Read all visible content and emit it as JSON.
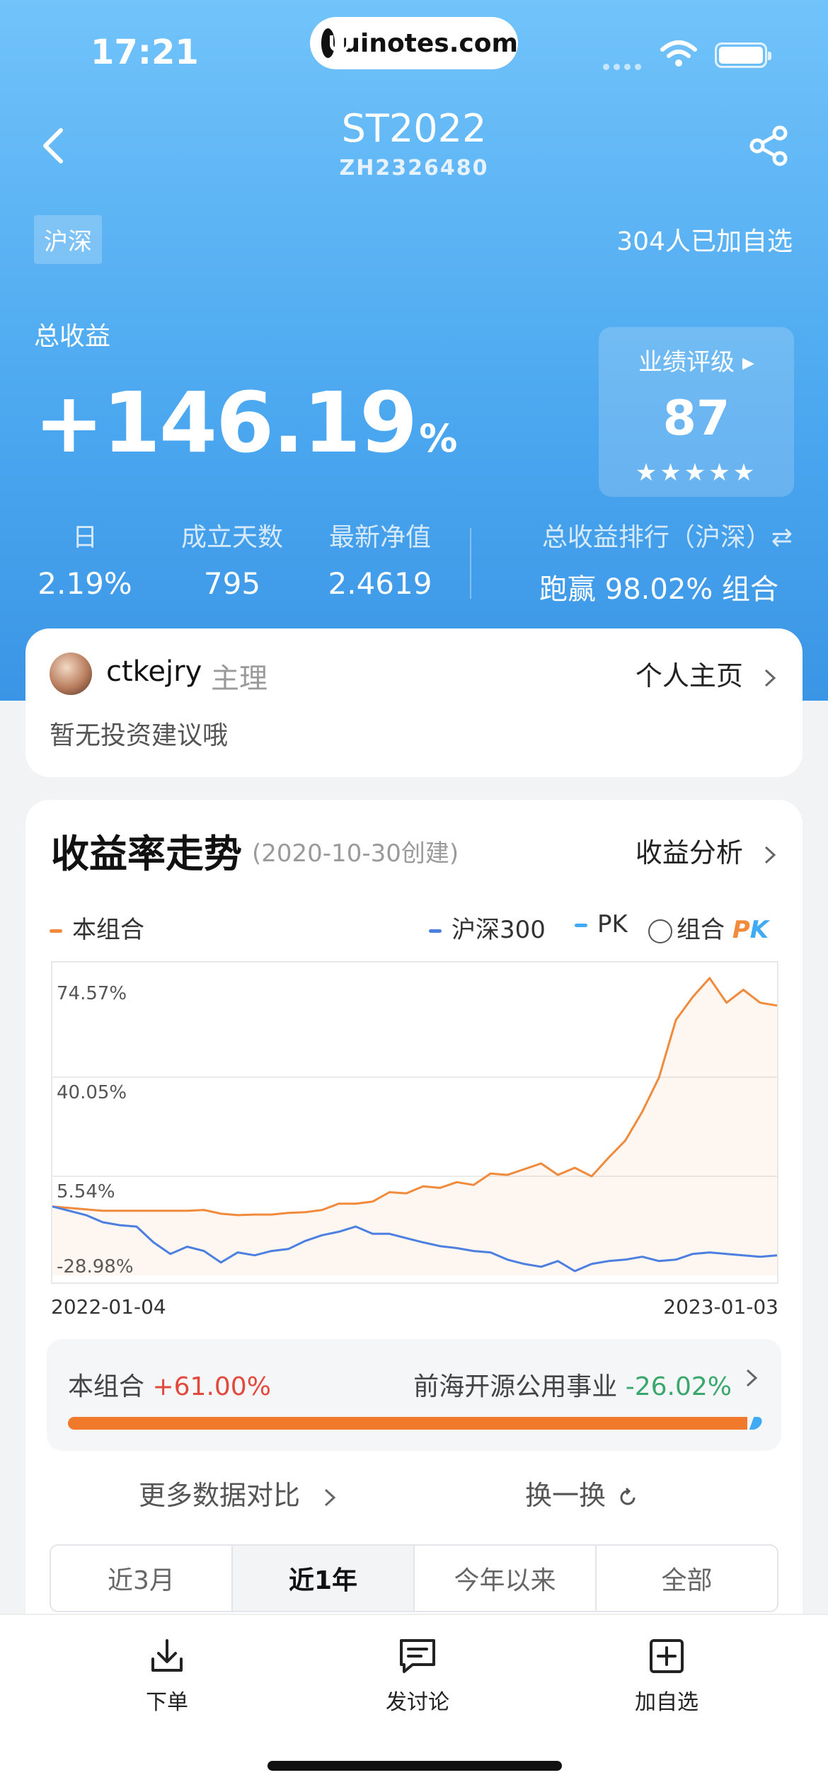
{
  "status_bar": {
    "time": "17:21",
    "pill_text": "uinotes.com"
  },
  "nav": {
    "title": "ST2022",
    "subtitle": "ZH2326480"
  },
  "market_tag": "沪深",
  "followers": "304人已加自选",
  "total_return": {
    "label": "总收益",
    "value": "+146.19",
    "unit": "%"
  },
  "rating": {
    "label": "业绩评级 ▸",
    "score": "87",
    "stars": "★★★★★",
    "star_value": 4.5
  },
  "stats": [
    {
      "label": "日",
      "value": "2.19%"
    },
    {
      "label": "成立天数",
      "value": "795"
    },
    {
      "label": "最新净值",
      "value": "2.4619"
    }
  ],
  "rank": {
    "label": "总收益排行（沪深）⇄",
    "value": "跑赢 98.02% 组合"
  },
  "manager": {
    "name": "ctkejry",
    "role": "主理",
    "home_link": "个人主页",
    "advice": "暂无投资建议哦"
  },
  "chart": {
    "title": "收益率走势",
    "created": "(2020-10-30创建)",
    "analysis_link": "收益分析",
    "legend": {
      "portfolio": "本组合",
      "index": "沪深300",
      "pk": "PK",
      "compare": "组合",
      "compare_badge_p": "P",
      "compare_badge_k": "K"
    },
    "colors": {
      "portfolio": "#f08a3c",
      "index": "#4d7fe0",
      "pk": "#41aaf5"
    }
  },
  "chart_data": {
    "type": "line",
    "x_labels": [
      "2022-01-04",
      "2023-01-03"
    ],
    "y_ticks": [
      "74.57%",
      "40.05%",
      "5.54%",
      "-28.98%"
    ],
    "ylim": [
      -28.98,
      74.57
    ],
    "series": [
      {
        "name": "本组合",
        "values": [
          -5,
          -5.5,
          -6,
          -6.5,
          -6.5,
          -6.5,
          -6.5,
          -6.5,
          -6.5,
          -6.2,
          -7.5,
          -8.0,
          -7.8,
          -7.8,
          -7.2,
          -7.0,
          -6.2,
          -4.0,
          -4.0,
          -3.3,
          0,
          -0.4,
          2.0,
          1.5,
          3.5,
          2.5,
          6.5,
          6.0,
          8.0,
          10.0,
          6.0,
          8.5,
          5.5,
          12.0,
          18.0,
          28.0,
          40.0,
          60.0,
          68.0,
          74.57,
          66.0,
          70.5,
          66.0,
          65.0
        ]
      },
      {
        "name": "沪深300",
        "values": [
          -5,
          -6.5,
          -8.0,
          -10.5,
          -11.5,
          -12.0,
          -17.5,
          -21.5,
          -19.0,
          -20.5,
          -24.5,
          -21.0,
          -22.0,
          -20.5,
          -19.8,
          -17.0,
          -15.0,
          -13.8,
          -12.0,
          -14.5,
          -14.5,
          -16.0,
          -17.5,
          -18.8,
          -19.5,
          -20.5,
          -21.0,
          -23.5,
          -25.0,
          -26.0,
          -24.0,
          -27.5,
          -25.0,
          -24.0,
          -23.5,
          -22.5,
          -24.0,
          -23.5,
          -21.5,
          -21.0,
          -21.5,
          -22.0,
          -22.5,
          -22.0
        ]
      }
    ],
    "pk_compare": {
      "portfolio_label": "本组合",
      "portfolio_value": "+61.00%",
      "rival_label": "前海开源公用事业",
      "rival_value": "-26.02%",
      "portfolio_share": 0.986
    }
  },
  "more_compare": "更多数据对比",
  "swap": "换一换",
  "range_tabs": [
    "近3月",
    "近1年",
    "今年以来",
    "全部"
  ],
  "range_active_index": 1,
  "bottom_bar": {
    "order": "下单",
    "discuss": "发讨论",
    "add_watch": "加自选"
  }
}
